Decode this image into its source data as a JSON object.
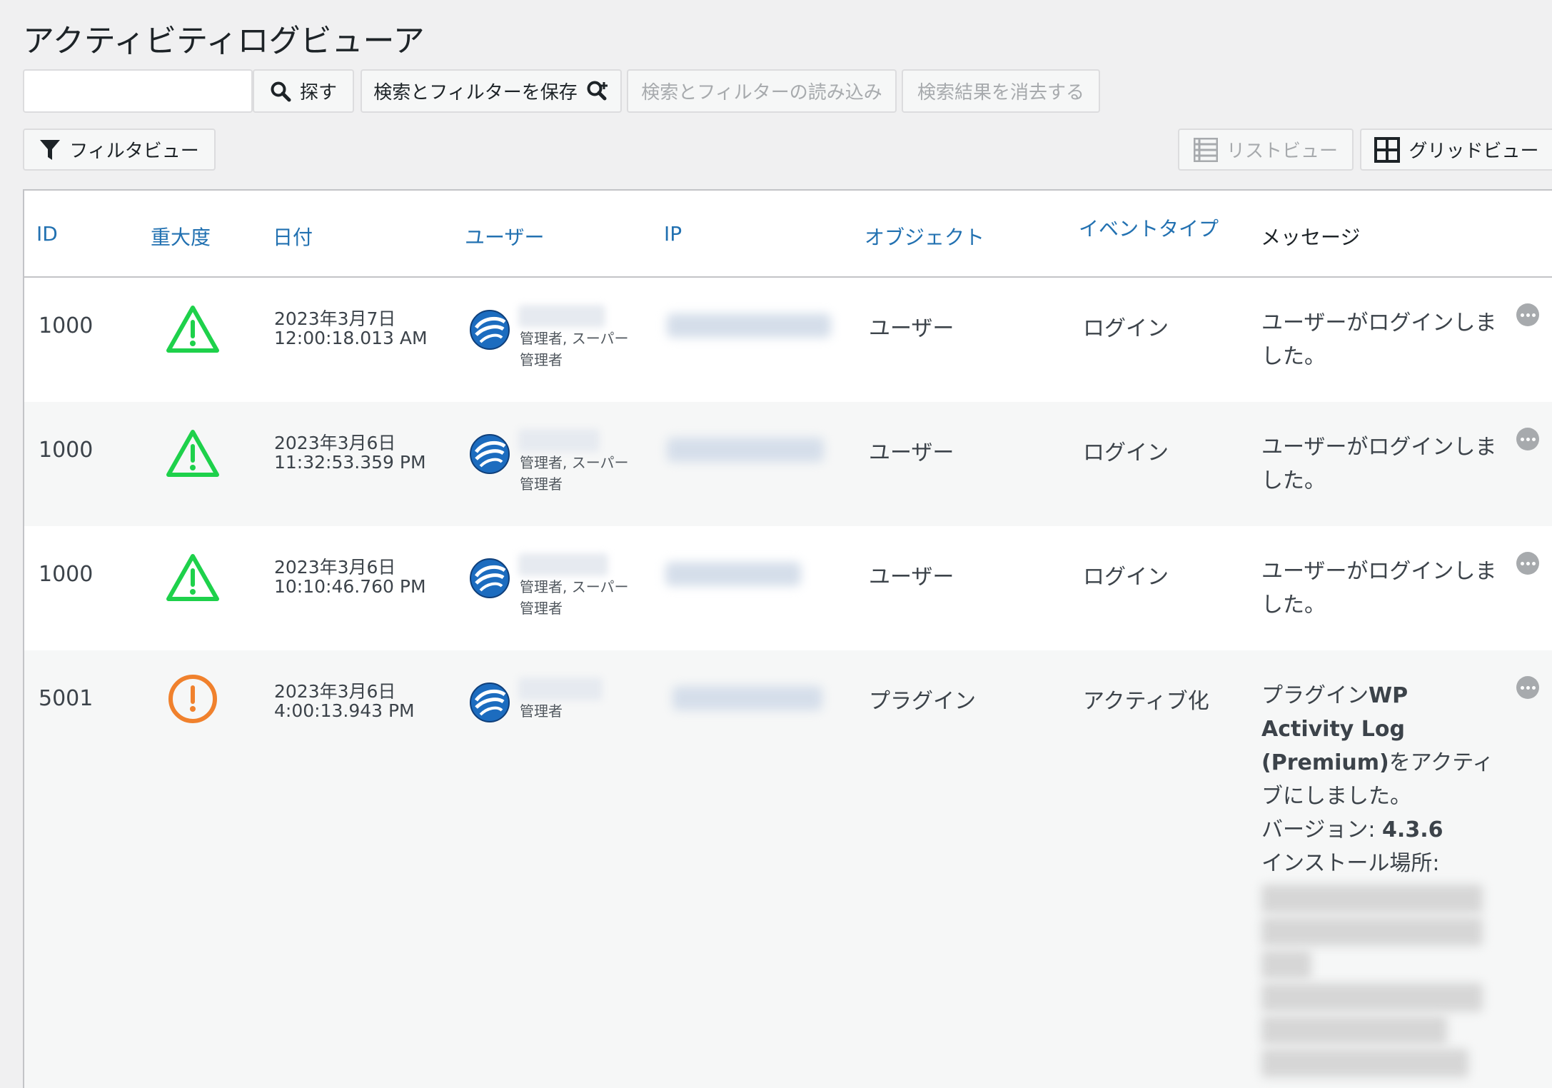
{
  "title": "アクティビティログビューア",
  "toolbar": {
    "search_value": "",
    "search_button": "探す",
    "save_filters": "検索とフィルターを保存",
    "load_filters": "検索とフィルターの読み込み",
    "clear_results": "検索結果を消去する",
    "filter_view": "フィルタビュー",
    "list_view": "リストビュー",
    "grid_view": "グリッドビュー"
  },
  "columns": {
    "id": "ID",
    "severity": "重大度",
    "date": "日付",
    "user": "ユーザー",
    "ip": "IP",
    "object": "オブジェクト",
    "event_type": "イベントタイプ",
    "message": "メッセージ"
  },
  "rows": [
    {
      "id": "1000",
      "severity": "warning-green",
      "date": "2023年3月7日",
      "time": "12:00:18.013 AM",
      "roles_line1": "管理者, スーパー",
      "roles_line2": "管理者",
      "object": "ユーザー",
      "event": "ログイン",
      "message": "ユーザーがログインしました。"
    },
    {
      "id": "1000",
      "severity": "warning-green",
      "date": "2023年3月6日",
      "time": "11:32:53.359 PM",
      "roles_line1": "管理者, スーパー",
      "roles_line2": "管理者",
      "object": "ユーザー",
      "event": "ログイン",
      "message": "ユーザーがログインしました。"
    },
    {
      "id": "1000",
      "severity": "warning-green",
      "date": "2023年3月6日",
      "time": "10:10:46.760 PM",
      "roles_line1": "管理者, スーパー",
      "roles_line2": "管理者",
      "object": "ユーザー",
      "event": "ログイン",
      "message": "ユーザーがログインしました。"
    },
    {
      "id": "5001",
      "severity": "alert-orange",
      "date": "2023年3月6日",
      "time": "4:00:13.943 PM",
      "roles_line1": "管理者",
      "object": "プラグイン",
      "event": "アクティブ化",
      "message_prefix": "プラグイン",
      "message_plugin": "WP Activity Log (Premium)",
      "message_suffix": "をアクティブにしました。",
      "version_label": "バージョン: ",
      "version_value": "4.3.6",
      "install_label": "インストール場所:"
    }
  ],
  "colors": {
    "link": "#2271b1",
    "green": "#1ed14b",
    "orange": "#f0812d"
  }
}
